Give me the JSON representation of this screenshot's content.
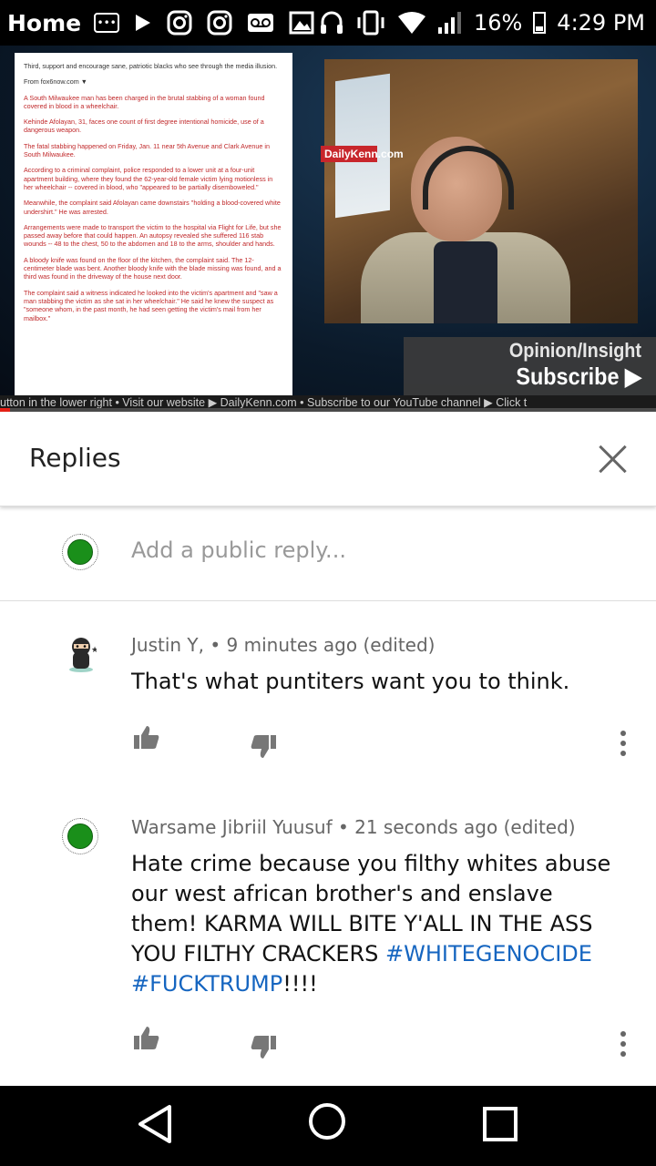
{
  "status_bar": {
    "home_label": "Home",
    "battery": "16%",
    "time": "4:29 PM"
  },
  "video": {
    "article_paragraphs": [
      {
        "text": "Third, support and encourage sane, patriotic blacks who see through the media illusion.",
        "style": "gray"
      },
      {
        "text": "From fox6now.com ▼",
        "style": "gray"
      },
      {
        "text": "A South Milwaukee man has been charged in the brutal stabbing of a woman found covered in blood in a wheelchair.",
        "style": "red"
      },
      {
        "text": "Kehinde Afolayan, 31, faces one count of first degree intentional homicide, use of a dangerous weapon.",
        "style": "red"
      },
      {
        "text": "The fatal stabbing happened on Friday, Jan. 11 near 5th Avenue and Clark Avenue in South Milwaukee.",
        "style": "red"
      },
      {
        "text": "According to a criminal complaint, police responded to a lower unit at a four-unit apartment building, where they found the 62-year-old female victim lying motionless in her wheelchair -- covered in blood, who \"appeared to be partially disemboweled.\"",
        "style": "red"
      },
      {
        "text": "Meanwhile, the complaint said Afolayan came downstairs \"holding a blood-covered white undershirt.\" He was arrested.",
        "style": "red"
      },
      {
        "text": "Arrangements were made to transport the victim to the hospital via Flight for Life, but she passed away before that could happen. An autopsy revealed she suffered 116 stab wounds -- 48 to the chest, 50 to the abdomen and 18 to the arms, shoulder and hands.",
        "style": "red"
      },
      {
        "text": "A bloody knife was found on the floor of the kitchen, the complaint said. The 12-centimeter blade was bent. Another bloody knife with the blade missing was found, and a third was found in the driveway of the house next door.",
        "style": "red"
      },
      {
        "text": "The complaint said a witness indicated he looked into the victim's apartment and \"saw a man stabbing the victim as she sat in her wheelchair.\" He said he knew the suspect as \"someone whom, in the past month, he had seen getting the victim's mail from her mailbox.\"",
        "style": "red"
      }
    ],
    "logo_text": "DailyKenn.com",
    "opinion_title": "Opinion/Insight",
    "subscribe_label": "Subscribe ▶",
    "ticker_text": "utton in the lower right   •   Visit our website ▶ DailyKenn.com   •   Subscribe to our YouTube channel ▶ Click t",
    "progress_fraction": 0.015,
    "colors": {
      "logo_red": "#c8262b",
      "article_red": "#c0282a",
      "progress_red": "#e62117"
    }
  },
  "replies": {
    "title": "Replies",
    "close_icon": "close-icon",
    "input_placeholder": "Add a public reply..."
  },
  "comments": [
    {
      "author": "Justin Y,",
      "time": "9 minutes ago",
      "edited": "(edited)",
      "text": "That's what puntiters want you to think.",
      "avatar": "ninja-avatar"
    },
    {
      "author": "Warsame Jibriil Yuusuf",
      "time": "21 seconds ago",
      "edited": "(edited)",
      "text": "Hate crime because you filthy whites abuse our west african brother's and enslave them! KARMA WILL BITE Y'ALL IN THE ASS YOU FILTHY CRACKERS ",
      "hashtag1": "#WHITEGENOCIDE",
      "hashtag2": "#FUCKTRUMP",
      "trailing": "!!!!",
      "avatar": "green-circle-avatar"
    }
  ],
  "accent_colors": {
    "hashtag_blue": "#1565c0",
    "avatar_green": "#1a8f1a"
  }
}
